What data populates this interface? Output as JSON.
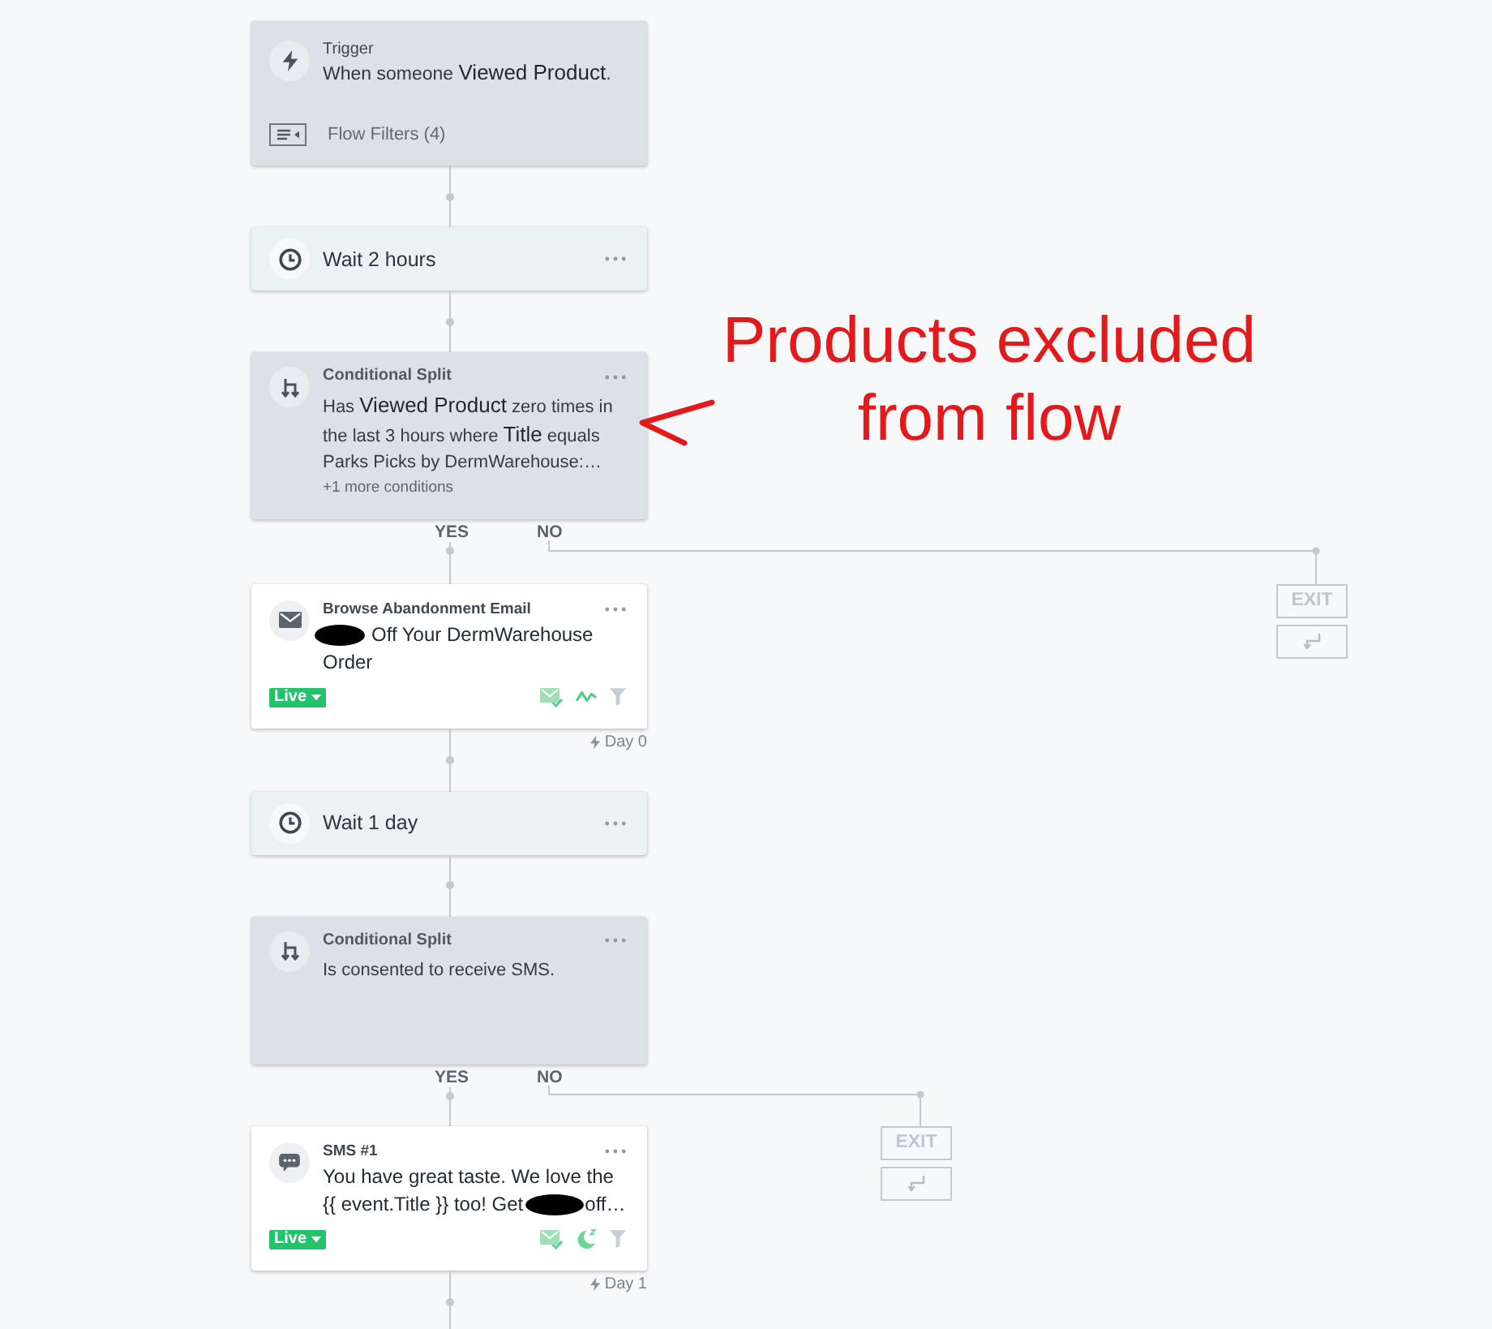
{
  "flow": [
    {
      "kind": "trigger",
      "label": "Trigger",
      "text": "When someone **Viewed Product**.",
      "filters": "Flow Filters (4)"
    },
    {
      "kind": "wait",
      "text": "Wait 2 hours"
    },
    {
      "kind": "split",
      "label": "Conditional Split",
      "text": "Has **Viewed Product** zero times in the last 3 hours where **Title** equals Parks Picks by DermWarehouse:…",
      "more": "+1 more conditions",
      "yes": "YES",
      "no": "NO",
      "exit": "EXIT"
    },
    {
      "kind": "email",
      "label": "Browse Abandonment Email",
      "message_lines": [
        [
          {
            "kind": "redaction"
          },
          {
            "kind": "text",
            "text": "Off Your DermWarehouse"
          }
        ],
        [
          {
            "kind": "text",
            "text": "Order"
          }
        ]
      ],
      "status": "Live",
      "delay": "Day 0"
    },
    {
      "kind": "wait",
      "text": "Wait 1 day"
    },
    {
      "kind": "split",
      "label": "Conditional Split",
      "text": "Is consented to receive SMS.",
      "yes": "YES",
      "no": "NO",
      "exit": "EXIT"
    },
    {
      "kind": "sms",
      "label": "SMS #1",
      "message_lines": [
        [
          {
            "kind": "text",
            "text": "You have great taste. We love the"
          }
        ],
        [
          {
            "kind": "text",
            "text": "{{ event.Title }} too! Get"
          },
          {
            "kind": "redaction"
          },
          {
            "kind": "text",
            "text": "off…"
          }
        ]
      ],
      "status": "Live",
      "delay": "Day 1"
    }
  ],
  "annotation": {
    "text": "Products excluded from flow"
  }
}
